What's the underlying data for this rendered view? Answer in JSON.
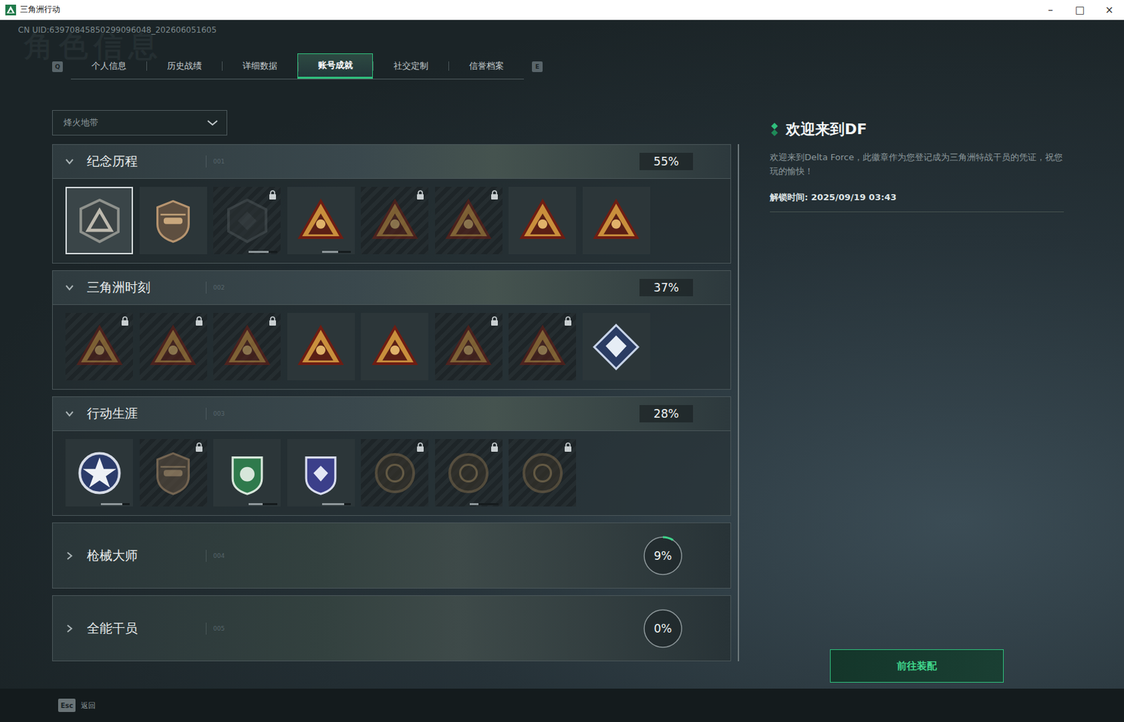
{
  "window": {
    "title": "三角洲行动",
    "controls": [
      "–",
      "□",
      "×"
    ]
  },
  "uid": "CN UID:63970845850299096048_202606051605",
  "watermark": "角色信息",
  "tabs": {
    "prev_key": "Q",
    "next_key": "E",
    "items": [
      {
        "label": "个人信息",
        "selected": false
      },
      {
        "label": "历史战绩",
        "selected": false
      },
      {
        "label": "详细数据",
        "selected": false
      },
      {
        "label": "账号成就",
        "selected": true
      },
      {
        "label": "社交定制",
        "selected": false
      },
      {
        "label": "信誉档案",
        "selected": false
      }
    ]
  },
  "mode_dropdown": {
    "value": "烽火地带"
  },
  "categories": [
    {
      "title": "纪念历程",
      "index": "001",
      "percent": "55%",
      "expanded": true,
      "badges": [
        {
          "locked": false,
          "selected": true
        },
        {
          "locked": false,
          "selected": false
        },
        {
          "locked": true,
          "selected": false,
          "level": 0.7
        },
        {
          "locked": false,
          "selected": false,
          "level": 0.55
        },
        {
          "locked": true,
          "selected": false
        },
        {
          "locked": true,
          "selected": false
        },
        {
          "locked": false,
          "selected": false
        },
        {
          "locked": false,
          "selected": false
        }
      ]
    },
    {
      "title": "三角洲时刻",
      "index": "002",
      "percent": "37%",
      "expanded": true,
      "badges": [
        {
          "locked": true,
          "selected": false
        },
        {
          "locked": true,
          "selected": false
        },
        {
          "locked": true,
          "selected": false
        },
        {
          "locked": false,
          "selected": false
        },
        {
          "locked": false,
          "selected": false
        },
        {
          "locked": true,
          "selected": false
        },
        {
          "locked": true,
          "selected": false
        },
        {
          "locked": false,
          "selected": false
        }
      ]
    },
    {
      "title": "行动生涯",
      "index": "003",
      "percent": "28%",
      "expanded": true,
      "badges": [
        {
          "locked": false,
          "selected": false,
          "level": 0.75
        },
        {
          "locked": true,
          "selected": false
        },
        {
          "locked": false,
          "selected": false,
          "level": 0.5
        },
        {
          "locked": false,
          "selected": false,
          "level": 0.75
        },
        {
          "locked": true,
          "selected": false
        },
        {
          "locked": true,
          "selected": false,
          "level": 0.3
        },
        {
          "locked": true,
          "selected": false
        }
      ]
    },
    {
      "title": "枪械大师",
      "index": "004",
      "percent": "9%",
      "expanded": false,
      "level": 0.09,
      "badges": []
    },
    {
      "title": "全能干员",
      "index": "005",
      "percent": "0%",
      "expanded": false,
      "level": 0,
      "badges": []
    }
  ],
  "detail": {
    "title": "欢迎来到DF",
    "description": "欢迎来到Delta Force，此徽章作为您登记成为三角洲特战干员的凭证，祝您玩的愉快！",
    "unlock_time": "解锁时间: 2025/09/19 03:43",
    "button": "前往装配"
  },
  "footer": {
    "key": "Esc",
    "label": "返回"
  }
}
